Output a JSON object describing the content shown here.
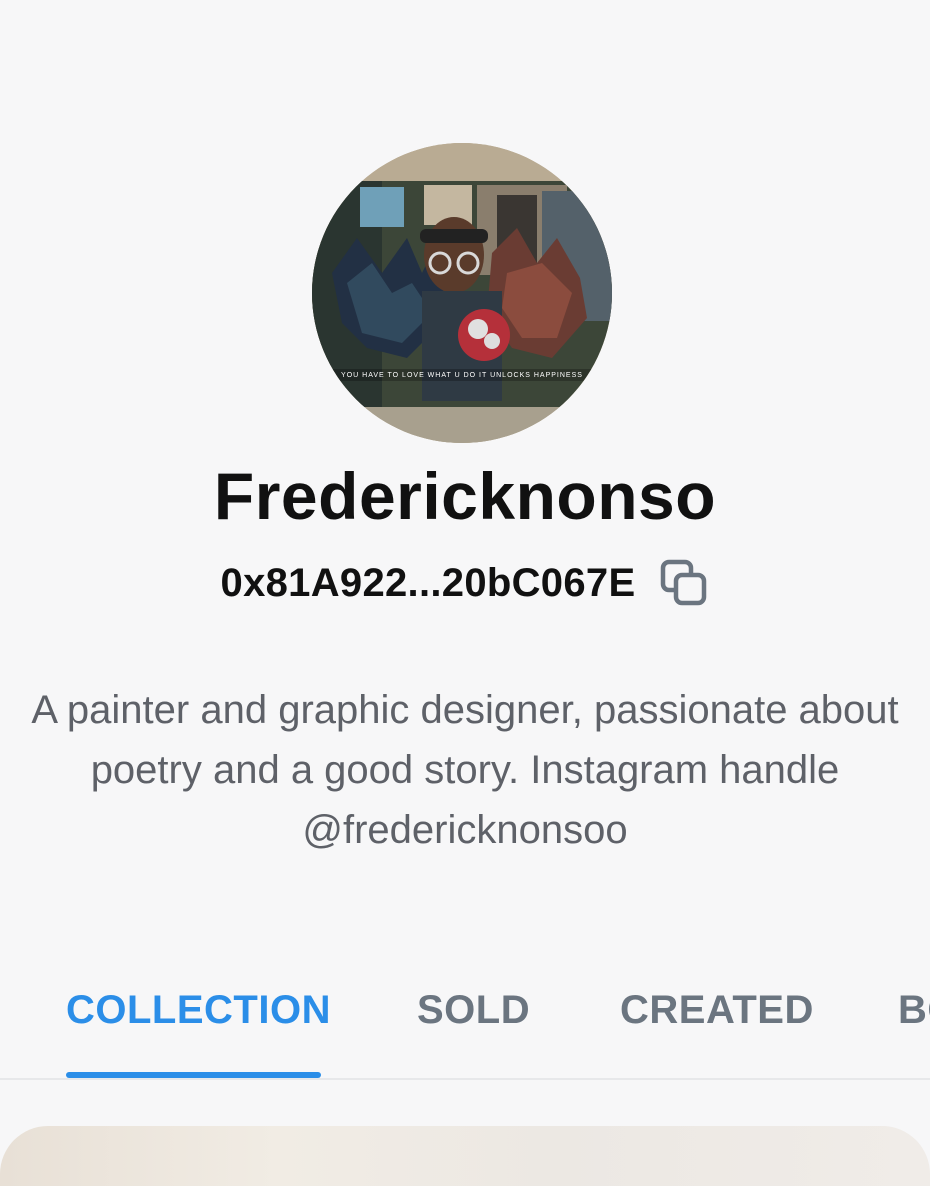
{
  "profile": {
    "username": "Fredericknonso",
    "wallet_address": "0x81A922...20bC067E",
    "bio": "A painter and graphic designer, passionate about poetry and a good story. Instagram handle @fredericknonsoo",
    "avatar_caption": "YOU HAVE TO LOVE WHAT U DO IT UNLOCKS HAPPINESS"
  },
  "tabs": [
    {
      "label": "COLLECTION",
      "active": true
    },
    {
      "label": "SOLD",
      "active": false
    },
    {
      "label": "CREATED",
      "active": false
    },
    {
      "label": "BO",
      "active": false
    }
  ],
  "icons": {
    "copy": "copy-icon"
  },
  "colors": {
    "background": "#f7f7f8",
    "text_primary": "#111111",
    "text_secondary": "#5e6168",
    "tab_inactive": "#6b7580",
    "accent": "#2b8ee8"
  }
}
